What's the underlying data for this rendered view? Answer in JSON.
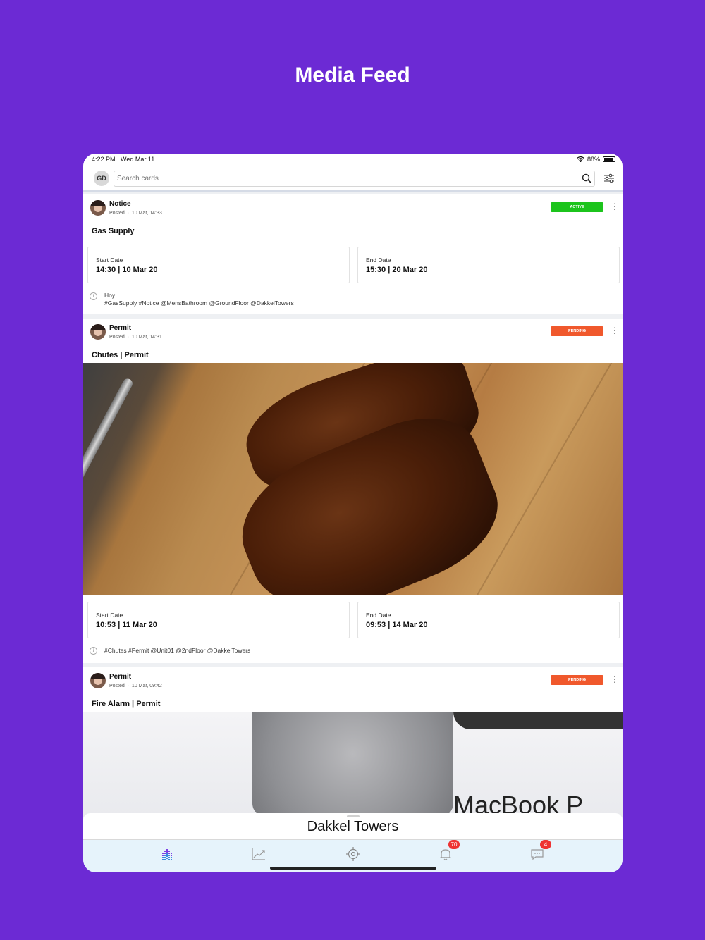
{
  "headline": "Media Feed",
  "status_bar": {
    "time": "4:22 PM",
    "date": "Wed Mar 11",
    "battery": "88%"
  },
  "search": {
    "avatar_initials": "GD",
    "placeholder": "Search cards"
  },
  "cards": [
    {
      "type": "Notice",
      "posted_label": "Posted",
      "posted_time": "10 Mar, 14:33",
      "status": "ACTIVE",
      "status_color": "#1cc41c",
      "title": "Gas Supply",
      "start_label": "Start Date",
      "start_value": "14:30 | 10 Mar 20",
      "end_label": "End Date",
      "end_value": "15:30 | 20 Mar 20",
      "desc_line1": "Hoy",
      "desc_line2": "#GasSupply #Notice @MensBathroom @GroundFloor @DakkelTowers"
    },
    {
      "type": "Permit",
      "posted_label": "Posted",
      "posted_time": "10 Mar, 14:31",
      "status": "PENDING",
      "status_color": "#f0582c",
      "title": "Chutes | Permit",
      "start_label": "Start Date",
      "start_value": "10:53 | 11 Mar 20",
      "end_label": "End Date",
      "end_value": "09:53 | 14 Mar 20",
      "desc_line1": "#Chutes #Permit @Unit01 @2ndFloor @DakkelTowers"
    },
    {
      "type": "Permit",
      "posted_label": "Posted",
      "posted_time": "10 Mar, 09:42",
      "status": "PENDING",
      "status_color": "#f0582c",
      "title": "Fire Alarm | Permit",
      "photo_text": "MacBook P"
    }
  ],
  "bottom_panel": {
    "building": "Dakkel Towers"
  },
  "tabbar": {
    "tabs": [
      {
        "icon": "feed-icon",
        "badge": ""
      },
      {
        "icon": "chart-icon",
        "badge": ""
      },
      {
        "icon": "target-icon",
        "badge": ""
      },
      {
        "icon": "bell-icon",
        "badge": "70"
      },
      {
        "icon": "chat-icon",
        "badge": "4"
      }
    ]
  },
  "colors": {
    "background": "#6c2ad4",
    "active_tab": "#7b3fe4"
  }
}
